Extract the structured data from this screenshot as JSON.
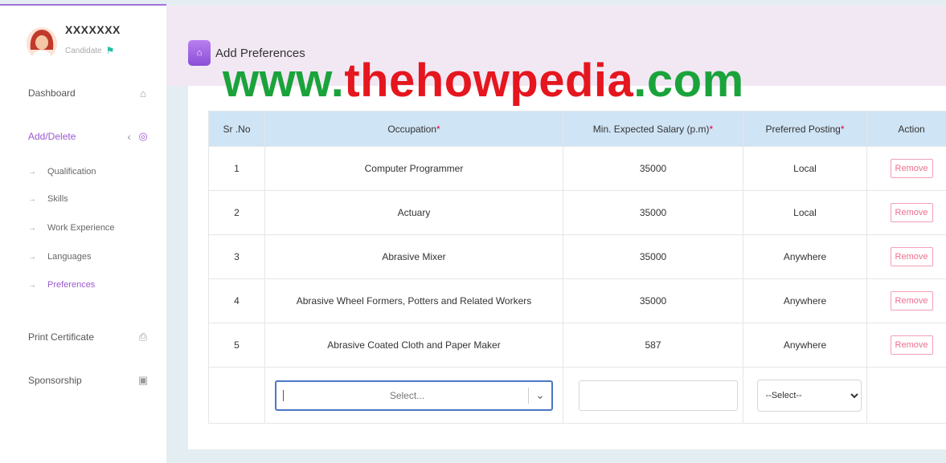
{
  "user": {
    "name": "XXXXXXX",
    "role": "Candidate"
  },
  "sidebar": {
    "items": [
      {
        "label": "Dashboard",
        "icon": "home-icon"
      },
      {
        "label": "Add/Delete",
        "icon": "target-icon"
      },
      {
        "label": "Print Certificate",
        "icon": "printer-icon"
      },
      {
        "label": "Sponsorship",
        "icon": "badge-icon"
      }
    ],
    "subitems": [
      "Qualification",
      "Skills",
      "Work Experience",
      "Languages",
      "Preferences"
    ]
  },
  "page": {
    "title": "Add Preferences"
  },
  "table": {
    "headers": [
      "Sr .No",
      "Occupation",
      "Min. Expected Salary (p.m)",
      "Preferred Posting",
      "Action"
    ],
    "required_mark": "*",
    "rows": [
      {
        "sr": "1",
        "occupation": "Computer Programmer",
        "salary": "35000",
        "posting": "Local",
        "action": "Remove"
      },
      {
        "sr": "2",
        "occupation": "Actuary",
        "salary": "35000",
        "posting": "Local",
        "action": "Remove"
      },
      {
        "sr": "3",
        "occupation": "Abrasive Mixer",
        "salary": "35000",
        "posting": "Anywhere",
        "action": "Remove"
      },
      {
        "sr": "4",
        "occupation": "Abrasive Wheel Formers, Potters and Related Workers",
        "salary": "35000",
        "posting": "Anywhere",
        "action": "Remove"
      },
      {
        "sr": "5",
        "occupation": "Abrasive Coated Cloth and Paper Maker",
        "salary": "587",
        "posting": "Anywhere",
        "action": "Remove"
      }
    ],
    "new_row": {
      "occupation_placeholder": "Select...",
      "salary_value": "",
      "posting_selected": "--Select--"
    }
  },
  "watermark": {
    "part1": "www.",
    "part2": "thehowpedia",
    "part3": ".com"
  },
  "colors": {
    "accent": "#9b59d0",
    "header_bg": "#cfe4f5",
    "remove": "#ee6f8f",
    "watermark_green": "#1aa33b",
    "watermark_red": "#e5161e"
  }
}
